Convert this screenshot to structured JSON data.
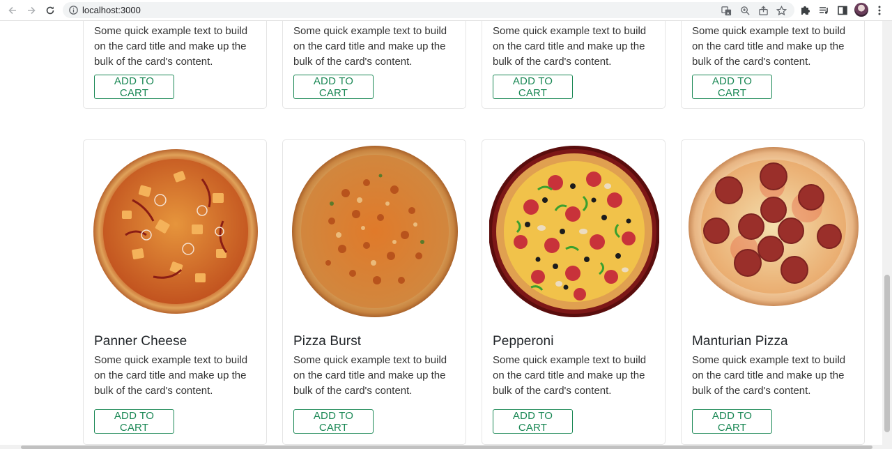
{
  "browser": {
    "url": "localhost:3000"
  },
  "card_common": {
    "description": "Some quick example text to build on the card title and make up the bulk of the card's content.",
    "button_label": "ADD TO CART",
    "button_color": "#198754"
  },
  "top_row": [
    {
      "description": "Some quick example text to build on the card title and make up the bulk of the card's content.",
      "button": "ADD TO CART"
    },
    {
      "description": "Some quick example text to build on the card title and make up the bulk of the card's content.",
      "button": "ADD TO CART"
    },
    {
      "description": "Some quick example text to build on the card title and make up the bulk of the card's content.",
      "button": "ADD TO CART"
    },
    {
      "description": "Some quick example text to build on the card title and make up the bulk of the card's content.",
      "button": "ADD TO CART"
    }
  ],
  "bottom_row": [
    {
      "title": "Panner Cheese",
      "image": "paneer-pizza-image",
      "description": "Some quick example text to build on the card title and make up the bulk of the card's content.",
      "button": "ADD TO CART"
    },
    {
      "title": "Pizza Burst",
      "image": "cheese-burst-pizza-image",
      "description": "Some quick example text to build on the card title and make up the bulk of the card's content.",
      "button": "ADD TO CART"
    },
    {
      "title": "Pepperoni",
      "image": "pepperoni-veggie-pizza-image",
      "description": "Some quick example text to build on the card title and make up the bulk of the card's content.",
      "button": "ADD TO CART"
    },
    {
      "title": "Manturian Pizza",
      "image": "salami-pizza-image",
      "description": "Some quick example text to build on the card title and make up the bulk of the card's content.",
      "button": "ADD TO CART"
    }
  ]
}
